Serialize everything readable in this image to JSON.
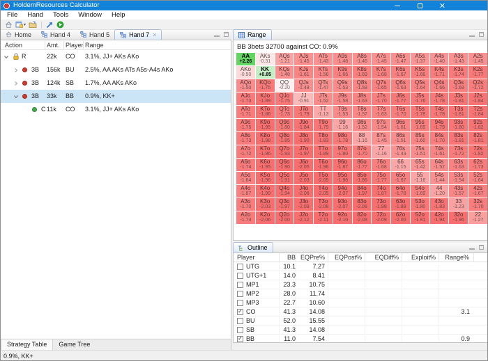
{
  "titlebar": {
    "title": "HoldemResources Calculator"
  },
  "menubar": {
    "items": [
      "File",
      "Hand",
      "Tools",
      "Window",
      "Help"
    ]
  },
  "toolbar": {
    "icons": [
      "home-icon",
      "new-hand-icon",
      "open-hand-icon",
      "publish-icon",
      "run-icon"
    ]
  },
  "editor_tabs": {
    "items": [
      {
        "label": "Home",
        "icon": "home",
        "active": false,
        "closable": false
      },
      {
        "label": "Hand 4",
        "icon": "hand",
        "active": false,
        "closable": false
      },
      {
        "label": "Hand 5",
        "icon": "hand",
        "active": false,
        "closable": false
      },
      {
        "label": "Hand 7",
        "icon": "hand",
        "active": true,
        "closable": true
      }
    ]
  },
  "action_tree": {
    "columns": [
      "Action",
      "Amt.",
      "Player",
      "Range"
    ],
    "rows": [
      {
        "expand": "open",
        "icon": "lock",
        "action": "R",
        "amt": "22k",
        "player": "CO",
        "range": "3.1%, JJ+ AKs AKo",
        "indent": 0,
        "selected": false
      },
      {
        "expand": "closed",
        "icon": "red-dot",
        "action": "3B",
        "amt": "156k",
        "player": "BU",
        "range": "2.5%, AA AKs ATs A5s-A4s AKo",
        "indent": 1,
        "selected": false
      },
      {
        "expand": "closed",
        "icon": "red-dot",
        "action": "3B",
        "amt": "124k",
        "player": "SB",
        "range": "1.7%, AA AKs AKo",
        "indent": 1,
        "selected": false
      },
      {
        "expand": "open",
        "icon": "red-dot",
        "action": "3B",
        "amt": "33k",
        "player": "BB",
        "range": "0.9%, KK+",
        "indent": 1,
        "selected": true
      },
      {
        "expand": "none",
        "icon": "green-dot",
        "action": "C",
        "amt": "11k",
        "player": "CO",
        "range": "3.1%, JJ+ AKs AKo",
        "indent": 2,
        "selected": false
      }
    ]
  },
  "strategy_tabs": {
    "items": [
      "Strategy Table",
      "Game Tree"
    ],
    "active_index": 0
  },
  "range_panel": {
    "tab_label": "Range",
    "subtitle": "BB 3bets 32700 against CO: 0.9%",
    "grid": {
      "hands": [
        [
          "AA",
          "AKs",
          "AQs",
          "AJs",
          "ATs",
          "A9s",
          "A8s",
          "A7s",
          "A6s",
          "A5s",
          "A4s",
          "A3s",
          "A2s"
        ],
        [
          "AKo",
          "KK",
          "KQs",
          "KJs",
          "KTs",
          "K9s",
          "K8s",
          "K7s",
          "K6s",
          "K5s",
          "K4s",
          "K3s",
          "K2s"
        ],
        [
          "AQo",
          "KQo",
          "QQ",
          "QJs",
          "QTs",
          "Q9s",
          "Q8s",
          "Q7s",
          "Q6s",
          "Q5s",
          "Q4s",
          "Q3s",
          "Q2s"
        ],
        [
          "AJo",
          "KJo",
          "QJo",
          "JJ",
          "JTs",
          "J9s",
          "J8s",
          "J7s",
          "J6s",
          "J5s",
          "J4s",
          "J3s",
          "J2s"
        ],
        [
          "ATo",
          "KTo",
          "QTo",
          "JTo",
          "TT",
          "T9s",
          "T8s",
          "T7s",
          "T6s",
          "T5s",
          "T4s",
          "T3s",
          "T2s"
        ],
        [
          "A9o",
          "K9o",
          "Q9o",
          "J9o",
          "T9o",
          "99",
          "98s",
          "97s",
          "96s",
          "95s",
          "94s",
          "93s",
          "92s"
        ],
        [
          "A8o",
          "K8o",
          "Q8o",
          "J8o",
          "T8o",
          "98o",
          "88",
          "87s",
          "86s",
          "85s",
          "84s",
          "83s",
          "82s"
        ],
        [
          "A7o",
          "K7o",
          "Q7o",
          "J7o",
          "T7o",
          "97o",
          "87o",
          "77",
          "76s",
          "75s",
          "74s",
          "73s",
          "72s"
        ],
        [
          "A6o",
          "K6o",
          "Q6o",
          "J6o",
          "T6o",
          "96o",
          "86o",
          "76o",
          "66",
          "65s",
          "64s",
          "63s",
          "62s"
        ],
        [
          "A5o",
          "K5o",
          "Q5o",
          "J5o",
          "T5o",
          "95o",
          "85o",
          "75o",
          "65o",
          "55",
          "54s",
          "53s",
          "52s"
        ],
        [
          "A4o",
          "K4o",
          "Q4o",
          "J4o",
          "T4o",
          "94o",
          "84o",
          "74o",
          "64o",
          "54o",
          "44",
          "43s",
          "42s"
        ],
        [
          "A3o",
          "K3o",
          "Q3o",
          "J3o",
          "T3o",
          "93o",
          "83o",
          "73o",
          "63o",
          "53o",
          "43o",
          "33",
          "32s"
        ],
        [
          "A2o",
          "K2o",
          "Q2o",
          "J2o",
          "T2o",
          "92o",
          "82o",
          "72o",
          "62o",
          "52o",
          "42o",
          "32o",
          "22"
        ]
      ],
      "values": [
        [
          2.26,
          -0.31,
          -1.21,
          -1.45,
          -1.43,
          -1.48,
          -1.46,
          -1.45,
          -1.47,
          -1.37,
          -1.4,
          -1.43,
          -1.45
        ],
        [
          -0.5,
          0.85,
          -1.48,
          -1.61,
          -1.58,
          -1.66,
          -1.69,
          -1.68,
          -1.67,
          -1.68,
          -1.71,
          -1.74,
          -1.77
        ],
        [
          -1.5,
          -1.75,
          -0.2,
          -1.48,
          -1.47,
          -1.53,
          -1.58,
          -1.65,
          -1.63,
          -1.64,
          -1.66,
          -1.69,
          -1.72
        ],
        [
          -1.73,
          -1.89,
          -1.75,
          -0.91,
          -1.52,
          -1.58,
          -1.63,
          -1.7,
          -1.77,
          -1.76,
          -1.78,
          -1.81,
          -1.84
        ],
        [
          -1.71,
          -1.86,
          -1.73,
          -1.78,
          -1.13,
          -1.53,
          -1.57,
          -1.63,
          -1.7,
          -1.78,
          -1.78,
          -1.81,
          -1.84
        ],
        [
          -1.75,
          -1.95,
          -1.8,
          -1.84,
          -1.79,
          -1.16,
          -1.52,
          -1.54,
          -1.61,
          -1.69,
          -1.79,
          -1.8,
          -1.82
        ],
        [
          -1.73,
          -1.98,
          -1.85,
          -1.9,
          -1.83,
          -1.78,
          -1.16,
          -1.45,
          -1.51,
          -1.6,
          -1.7,
          -1.81,
          -1.81
        ],
        [
          -1.72,
          -1.96,
          -1.93,
          -1.97,
          -1.89,
          -1.8,
          -1.7,
          -1.16,
          -1.43,
          -1.51,
          -1.61,
          -1.72,
          -1.82
        ],
        [
          -1.74,
          -1.95,
          -1.9,
          -2.05,
          -1.96,
          -1.87,
          -1.77,
          -1.68,
          -1.15,
          -1.42,
          -1.52,
          -1.63,
          -1.73
        ],
        [
          -1.64,
          -1.96,
          -1.91,
          -2.03,
          -2.05,
          -1.96,
          -1.86,
          -1.77,
          -1.67,
          -1.16,
          -1.44,
          -1.54,
          -1.64
        ],
        [
          -1.67,
          -1.99,
          -1.94,
          -2.06,
          -2.05,
          -2.07,
          -1.97,
          -1.87,
          -1.78,
          -1.69,
          -1.2,
          -1.57,
          -1.67
        ],
        [
          -1.7,
          -2.03,
          -1.97,
          -2.09,
          -2.08,
          -2.07,
          -2.08,
          -1.98,
          -1.89,
          -1.8,
          -1.83,
          -1.23,
          -1.7
        ],
        [
          -1.73,
          -2.06,
          -2.0,
          -2.12,
          -2.11,
          -2.1,
          -2.08,
          -2.09,
          -2.0,
          -1.91,
          -1.94,
          -1.96,
          -1.27
        ]
      ]
    }
  },
  "outline_panel": {
    "tab_label": "Outline",
    "columns": [
      "Player",
      "BB",
      "EQPre%",
      "EQPost%",
      "EQDiff%",
      "Exploit%",
      "Range%"
    ],
    "rows": [
      {
        "player": "UTG",
        "checked": false,
        "bb": "10.1",
        "eq_pre": "7.27",
        "eq_post": "",
        "eq_diff": "",
        "exploit": "",
        "range": ""
      },
      {
        "player": "UTG+1",
        "checked": false,
        "bb": "14.0",
        "eq_pre": "8.41",
        "eq_post": "",
        "eq_diff": "",
        "exploit": "",
        "range": ""
      },
      {
        "player": "MP1",
        "checked": false,
        "bb": "23.3",
        "eq_pre": "10.75",
        "eq_post": "",
        "eq_diff": "",
        "exploit": "",
        "range": ""
      },
      {
        "player": "MP2",
        "checked": false,
        "bb": "28.0",
        "eq_pre": "11.74",
        "eq_post": "",
        "eq_diff": "",
        "exploit": "",
        "range": ""
      },
      {
        "player": "MP3",
        "checked": false,
        "bb": "22.7",
        "eq_pre": "10.60",
        "eq_post": "",
        "eq_diff": "",
        "exploit": "",
        "range": ""
      },
      {
        "player": "CO",
        "checked": true,
        "bb": "41.3",
        "eq_pre": "14.08",
        "eq_post": "",
        "eq_diff": "",
        "exploit": "",
        "range": "3.1"
      },
      {
        "player": "BU",
        "checked": false,
        "bb": "52.0",
        "eq_pre": "15.55",
        "eq_post": "",
        "eq_diff": "",
        "exploit": "",
        "range": ""
      },
      {
        "player": "SB",
        "checked": false,
        "bb": "41.3",
        "eq_pre": "14.08",
        "eq_post": "",
        "eq_diff": "",
        "exploit": "",
        "range": ""
      },
      {
        "player": "BB",
        "checked": true,
        "bb": "11.0",
        "eq_pre": "7.54",
        "eq_post": "",
        "eq_diff": "",
        "exploit": "",
        "range": "0.9"
      }
    ]
  },
  "statusbar": {
    "text": "0.9%, KK+"
  },
  "colors": {
    "titlebar": "#1283d9",
    "selection": "#cbe4f6",
    "cell_negative": "#f86e6e",
    "cell_positive": "#60d460"
  }
}
